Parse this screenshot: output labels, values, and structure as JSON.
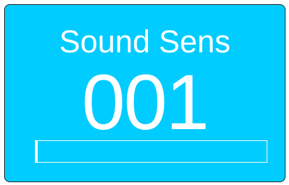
{
  "widget": {
    "title": "Sound Sens",
    "value": "001",
    "level_fraction": 0.01
  },
  "colors": {
    "background": "#00ccff",
    "text": "#ffffff",
    "border": "#222222"
  }
}
